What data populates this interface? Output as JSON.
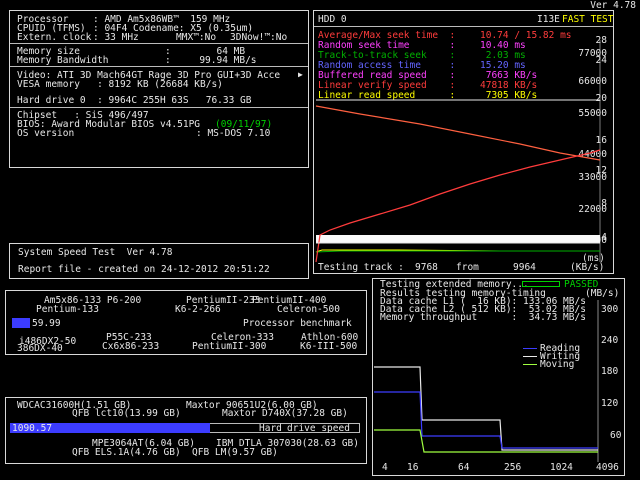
{
  "version": "Ver 4.78",
  "sysinfo": {
    "processor_label": "Processor",
    "processor_value": ": AMD Am5x86WB™  159 MHz",
    "cpuid_label": "CPUID (TFMS)",
    "cpuid_value": ": 04F4 Codename: X5 (0.35um)",
    "clock_label": "Extern. clock",
    "clock_value": ": 33 MHz",
    "mmx": "MMX™:No",
    "now": "3DNow!™:No",
    "memsize_label": "Memory size",
    "memsize_value": ":        64 MB",
    "memband_label": "Memory Bandwidth",
    "memband_value": ":     99.94 MB/s",
    "video_line": "Video: ATI 3D Mach64GT Rage 3D Pro GUI+3D Acce",
    "vesa_line": "VESA memory   : 8192 KB (26684 KB/s)",
    "hdd_line": "Hard drive 0  : 9964C 255H 63S   76.33 GB",
    "chipset_line": "Chipset   : SiS 496/497",
    "bios_line": "BIOS: Award Modular BIOS v4.51PG",
    "bios_date": "(09/11/97)",
    "os_label": "OS version",
    "os_value": ": MS-DOS 7.10"
  },
  "speedtest": {
    "title": "System Speed Test  Ver 4.78",
    "report": "Report file - created on 24-12-2012 20:51:22"
  },
  "cpu_bench": {
    "top1": "Am5x86-133 P6-200",
    "top1b": "PentiumII-233",
    "top1c": "PentiumII-400",
    "top2": "Pentium-133",
    "top2b": "K6-2-266",
    "top2c": "Celeron-500",
    "value": "59.99",
    "label": "Processor benchmark",
    "bot1": "P55C-233",
    "bot1b": "Celeron-333",
    "bot1c": "Athlon-600",
    "bot2a": "i486DX2-50",
    "bot2b": "Cx6x86-233",
    "bot2c": "PentiumII-300",
    "bot2d": "K6-III-500",
    "bot3": "386DX-40",
    "fill_ratio": 0.12
  },
  "hdd_bench": {
    "top1": "WDCAC31600H(1.51 GB)",
    "top1b": "Maxtor 90651U2(6.00 GB)",
    "top2": "QFB lct10(13.99 GB)",
    "top2b": "Maxtor D740X(37.28 GB)",
    "value": "1090.57",
    "label1": "Hard",
    "label2": "drive speed",
    "bot1": "MPE3064AT(6.04 GB)",
    "bot1b": "IBM DTLA 307030(28.63 GB)",
    "bot2": "QFB ELS.1A(4.76 GB)",
    "bot2b": "QFB LM(9.57 GB)",
    "fill_ratio": 0.57
  },
  "hdd_test": {
    "title": "HDD 0",
    "code": "I13E",
    "mode": "FAST TEST",
    "rows": [
      {
        "label": "Average/Max seek time  :",
        "value": "10.74 / 15.82 ms",
        "color": "#ff3c3c"
      },
      {
        "label": "Random seek time       :",
        "value": "10.40 ms",
        "color": "#ff40ff"
      },
      {
        "label": "Track-to-track seek    :",
        "value": " 2.03 ms",
        "color": "#00b000"
      },
      {
        "label": "Random access time     :",
        "value": "15.20 ms",
        "color": "#6464ff"
      },
      {
        "label": "Buffered read speed    :",
        "value": " 7663 KB/s",
        "color": "#ff40ff"
      },
      {
        "label": "Linear verify speed    :",
        "value": "47818 KB/s",
        "color": "#ff3c3c"
      },
      {
        "label": "Linear read speed      :",
        "value": " 7305 KB/s",
        "color": "#ffff00"
      }
    ],
    "axis_left": [
      "28",
      "24",
      "20",
      "16",
      "12",
      "8",
      "4"
    ],
    "axis_right": [
      "77000",
      "66000",
      "55000",
      "44000",
      "33000",
      "22000",
      "11000"
    ],
    "ms_unit": "(ms)",
    "kbs_unit": "(KB/s)",
    "testing_label": "Testing track :",
    "track_value": "9768",
    "from_label": "from",
    "track_total": "9964"
  },
  "mem_test": {
    "line1": "Testing extended memory...",
    "passed": "PASSED",
    "line2": "Results testing memory-timing",
    "unit": "(MB/s)",
    "l1_label": "Data cache L1 (  16 KB):",
    "l1_value": "133.06 MB/s",
    "l2_label": "Data cache L2 ( 512 KB):",
    "l2_value": " 53.02 MB/s",
    "tp_label": "Memory throughput      :",
    "tp_value": " 34.73 MB/s",
    "y_ticks": [
      "300",
      "240",
      "180",
      "120",
      "60"
    ],
    "x_ticks": [
      "4",
      "16",
      "64",
      "256",
      "1024",
      "4096"
    ],
    "legend": [
      {
        "name": "Reading",
        "color": "#3c3cff"
      },
      {
        "name": "Writing",
        "color": "#e8e8e8"
      },
      {
        "name": "Moving",
        "color": "#a0ff40"
      }
    ]
  },
  "chart_data": {
    "type": "line",
    "title": "HDD 0",
    "ylabel": "(ms)",
    "ylabel_right": "(KB/s)",
    "ylim": [
      0,
      28
    ],
    "ylim_right": [
      0,
      77000
    ],
    "series": [
      {
        "name": "Linear verify speed",
        "color": "#ff3c3c"
      },
      {
        "name": "Linear read speed",
        "color": "#ffff00"
      },
      {
        "name": "Track-to-track seek",
        "color": "#00b000"
      }
    ]
  }
}
